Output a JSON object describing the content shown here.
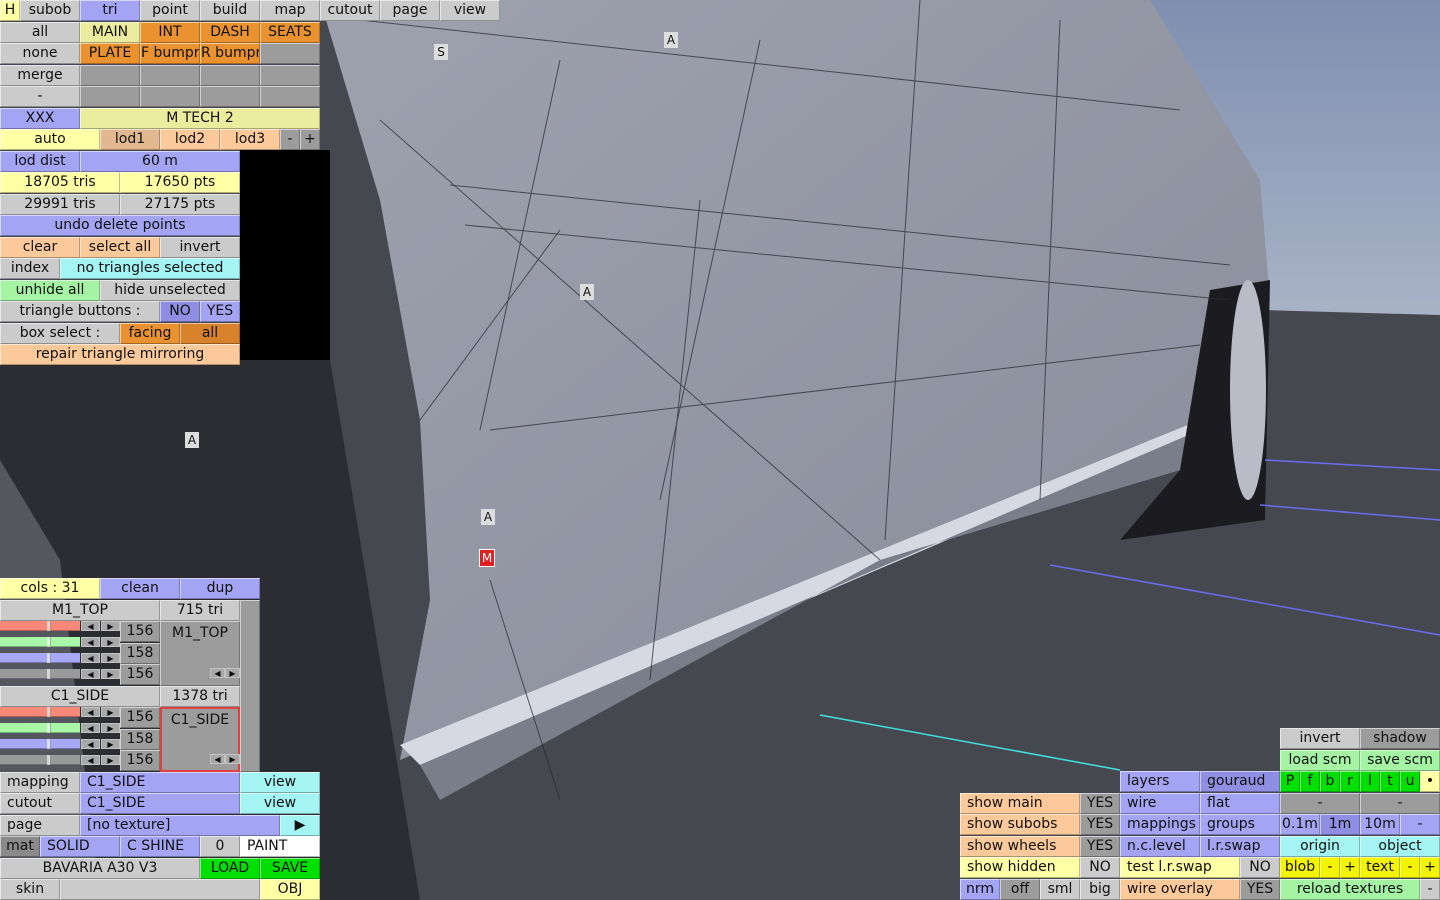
{
  "top_bar": [
    "H",
    "subob",
    "tri",
    "point",
    "build",
    "map",
    "cutout",
    "page",
    "view"
  ],
  "groups": {
    "row1": [
      "all",
      "MAIN",
      "INT",
      "DASH",
      "SEATS"
    ],
    "row2": [
      "none",
      "PLATE",
      "F bumpr",
      "R bumpr"
    ],
    "row3": [
      "merge"
    ],
    "row4": [
      "-"
    ]
  },
  "model": {
    "code": "XXX",
    "name": "M TECH 2"
  },
  "lod": {
    "auto": "auto",
    "lod1": "lod1",
    "lod2": "lod2",
    "lod3": "lod3",
    "minus": "-",
    "plus": "+",
    "dist_label": "lod dist",
    "dist_value": "60 m"
  },
  "stats": {
    "tris_a": "18705 tris",
    "pts_a": "17650 pts",
    "tris_b": "29991 tris",
    "pts_b": "27175 pts"
  },
  "tri_panel": {
    "undo": "undo delete points",
    "clear": "clear",
    "select_all": "select all",
    "invert": "invert",
    "index": "index",
    "selection_status": "no triangles selected",
    "unhide_all": "unhide all",
    "hide_unselected": "hide unselected",
    "triangle_buttons": "triangle buttons :",
    "no": "NO",
    "yes": "YES",
    "box_select": "box select :",
    "facing": "facing",
    "all": "all",
    "repair": "repair triangle mirroring"
  },
  "colours": {
    "cols": "cols : 31",
    "clean": "clean",
    "dup": "dup",
    "entries": [
      {
        "name": "M1_TOP",
        "count": "715 tri",
        "r": "156",
        "g": "158",
        "b": "156",
        "preview": "M1_TOP"
      },
      {
        "name": "C1_SIDE",
        "count": "1378 tri",
        "r": "156",
        "g": "158",
        "b": "156",
        "preview": "C1_SIDE"
      }
    ],
    "arrow_left": "◀",
    "arrow_right": "▶"
  },
  "material": {
    "mapping": "mapping",
    "mapping_value": "C1_SIDE",
    "view": "view",
    "cutout": "cutout",
    "cutout_value": "C1_SIDE",
    "page": "page",
    "page_value": "[no texture]",
    "page_arrow": "▶",
    "mat": "mat",
    "solid": "SOLID",
    "shine": "C SHINE",
    "shine_value": "0",
    "paint": "PAINT",
    "car_name": "BAVARIA A30 V3",
    "load": "LOAD",
    "save": "SAVE",
    "skin": "skin",
    "skin_value": "",
    "obj": "OBJ"
  },
  "display": {
    "invert": "invert",
    "shadow": "shadow",
    "load_scm": "load scm",
    "save_scm": "save scm",
    "layers": "layers",
    "gouraud": "gouraud",
    "views": [
      "P",
      "f",
      "b",
      "r",
      "l",
      "t",
      "u",
      "•"
    ],
    "show_main": "show main",
    "show_main_v": "YES",
    "wire": "wire",
    "flat": "flat",
    "dash1": "-",
    "dash2": "-",
    "show_subobs": "show subobs",
    "show_subobs_v": "YES",
    "mappings": "mappings",
    "groups": "groups",
    "grid": [
      "0.1m",
      "1m",
      "10m",
      "-"
    ],
    "show_wheels": "show wheels",
    "show_wheels_v": "YES",
    "nc_level": "n.c.level",
    "lr_swap": "l.r.swap",
    "origin": "origin",
    "object": "object",
    "show_hidden": "show hidden",
    "show_hidden_v": "NO",
    "test_lr_swap": "test l.r.swap",
    "test_lr_swap_v": "NO",
    "blob": "blob",
    "blob_minus": "-",
    "blob_plus": "+",
    "text": "text",
    "text_minus": "-",
    "text_plus": "+",
    "normals": [
      "nrm",
      "off",
      "sml",
      "big"
    ],
    "wire_overlay": "wire overlay",
    "wire_overlay_v": "YES",
    "reload_textures": "reload textures",
    "reload_minus": "-"
  },
  "viewport_markers": [
    "S",
    "A",
    "A",
    "A",
    "A",
    "M"
  ]
}
